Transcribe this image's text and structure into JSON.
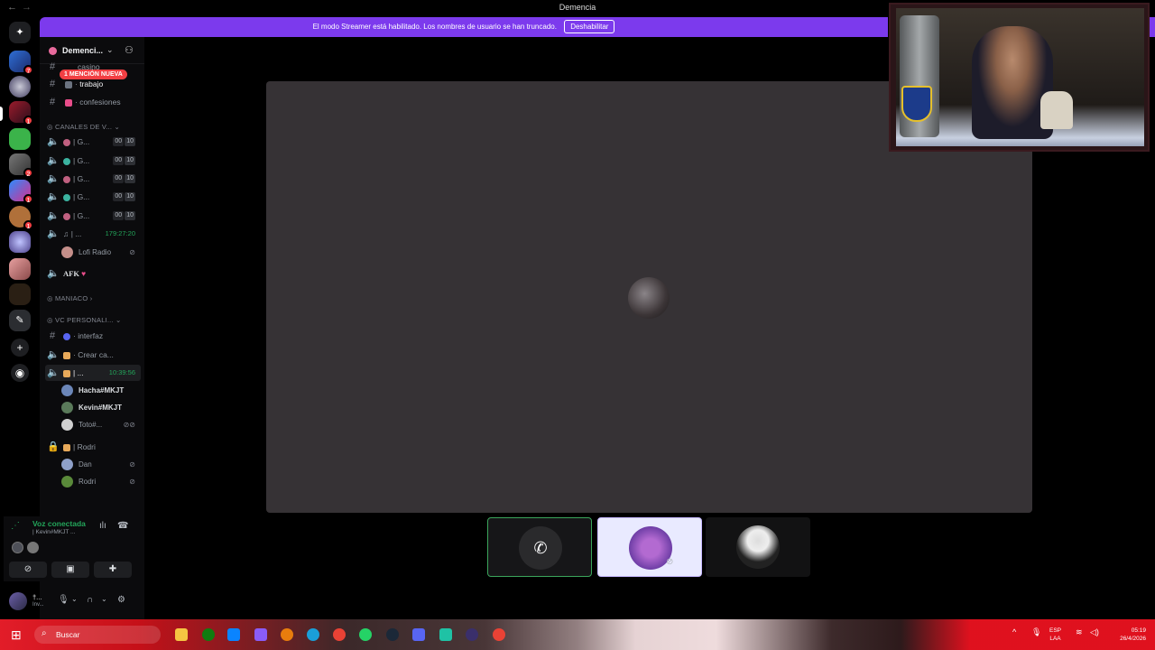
{
  "window": {
    "title": "Demencia"
  },
  "banner": {
    "message": "El modo Streamer está habilitado. Los nombres de usuario se han truncado.",
    "disable_label": "Deshabilitar"
  },
  "guild_badges": [
    "7",
    "1",
    "2",
    "1",
    "1"
  ],
  "server": {
    "name": "Demenci..."
  },
  "mention_pill": "1 MENCIÓN NUEVA",
  "channels_top": [
    {
      "label": "casino"
    },
    {
      "label": "trabajo"
    },
    {
      "label": "confesiones"
    }
  ],
  "categories": {
    "voice": "CANALES DE V...",
    "maniaco": "MANIACO",
    "vc_personal": "VC PERSONALI..."
  },
  "voice_channels": [
    {
      "label": "| G...",
      "count": "00",
      "limit": "10"
    },
    {
      "label": "| G...",
      "count": "00",
      "limit": "10"
    },
    {
      "label": "| G...",
      "count": "00",
      "limit": "10"
    },
    {
      "label": "| G...",
      "count": "00",
      "limit": "10"
    },
    {
      "label": "| G...",
      "count": "00",
      "limit": "10"
    }
  ],
  "music_channel": {
    "label": "| ...",
    "timer": "179:27:20",
    "member": "Lofi Radio"
  },
  "afk_channel": {
    "label": "AFK"
  },
  "personal": {
    "interfaz": "interfaz",
    "crear": "Crear ca...",
    "active": {
      "label": "| ...",
      "timer": "10:39:56"
    },
    "members": [
      "Hacha#MKJT",
      "Kevin#MKJT",
      "Toto#..."
    ],
    "locked": {
      "label": "| Rodri",
      "members": [
        "Dan",
        "Rodri"
      ]
    }
  },
  "voice_panel": {
    "status": "Voz conectada",
    "channel": "| Kevin#MKJT ..."
  },
  "user_panel": {
    "name": "†...",
    "status": "Inv..."
  },
  "taskbar": {
    "search": "Buscar",
    "lang1": "ESP",
    "lang2": "LAA",
    "time": "05:19",
    "date": "26/4/2026"
  },
  "colors": {
    "banner": "#7c3aed",
    "connected": "#23a55a",
    "mention": "#f23f43",
    "stage": "#363235"
  }
}
